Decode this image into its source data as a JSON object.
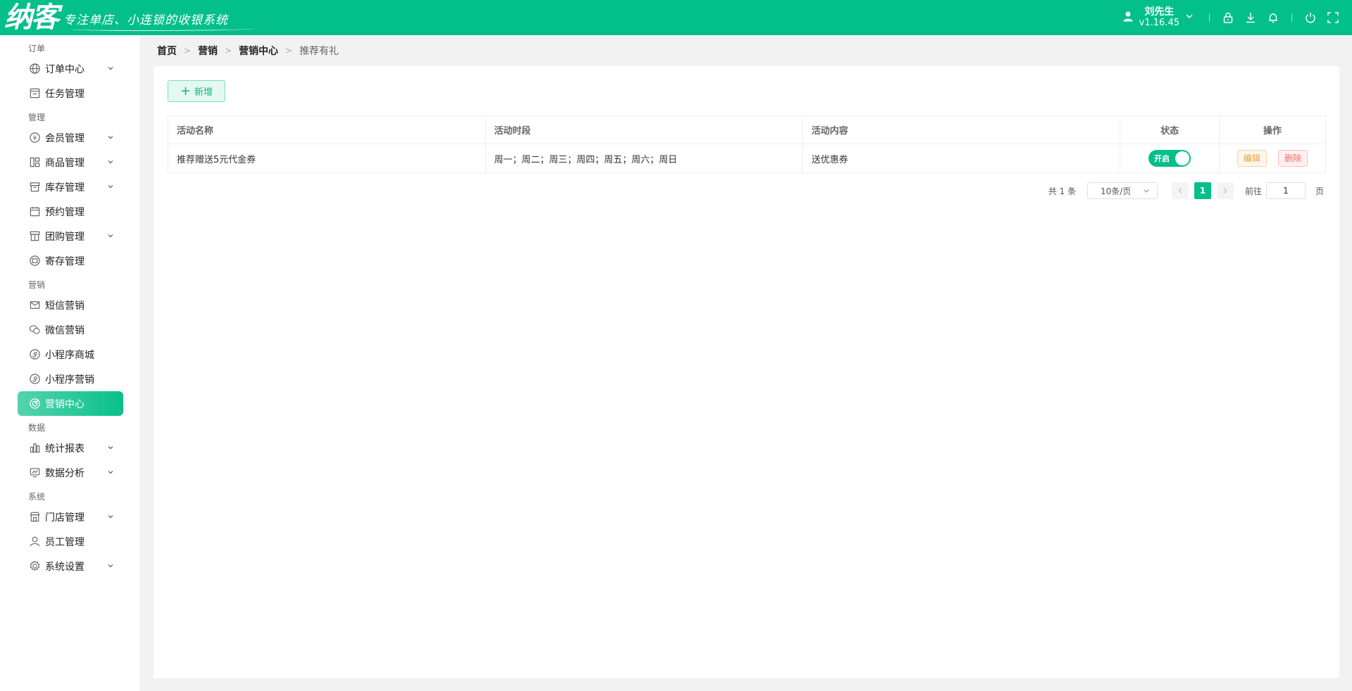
{
  "header": {
    "logo": "纳客",
    "slogan": "专注单店、小连锁的收银系统",
    "user_name": "刘先生",
    "version": "v1.16.45",
    "icons": [
      "user-icon",
      "chevron-down-icon",
      "lock-icon",
      "download-icon",
      "bell-icon",
      "power-icon",
      "fullscreen-icon"
    ]
  },
  "sidebar": {
    "groups": [
      {
        "label": "订单",
        "items": [
          {
            "label": "订单中心",
            "icon": "globe-icon",
            "chevron": true
          },
          {
            "label": "任务管理",
            "icon": "task-icon",
            "chevron": false
          }
        ]
      },
      {
        "label": "管理",
        "items": [
          {
            "label": "会员管理",
            "icon": "member-icon",
            "chevron": true
          },
          {
            "label": "商品管理",
            "icon": "goods-icon",
            "chevron": true
          },
          {
            "label": "库存管理",
            "icon": "inventory-icon",
            "chevron": true
          },
          {
            "label": "预约管理",
            "icon": "calendar-icon",
            "chevron": false
          },
          {
            "label": "团购管理",
            "icon": "groupbuy-icon",
            "chevron": true
          },
          {
            "label": "寄存管理",
            "icon": "storage-icon",
            "chevron": false
          }
        ]
      },
      {
        "label": "营销",
        "items": [
          {
            "label": "短信营销",
            "icon": "sms-icon",
            "chevron": false
          },
          {
            "label": "微信营销",
            "icon": "wechat-icon",
            "chevron": false
          },
          {
            "label": "小程序商城",
            "icon": "miniprogram-icon",
            "chevron": false
          },
          {
            "label": "小程序营销",
            "icon": "miniprogram-icon",
            "chevron": false
          },
          {
            "label": "营销中心",
            "icon": "target-icon",
            "chevron": false,
            "active": true
          }
        ]
      },
      {
        "label": "数据",
        "items": [
          {
            "label": "统计报表",
            "icon": "bar-chart-icon",
            "chevron": true
          },
          {
            "label": "数据分析",
            "icon": "analytics-icon",
            "chevron": true
          }
        ]
      },
      {
        "label": "系统",
        "items": [
          {
            "label": "门店管理",
            "icon": "store-icon",
            "chevron": true
          },
          {
            "label": "员工管理",
            "icon": "staff-icon",
            "chevron": false
          },
          {
            "label": "系统设置",
            "icon": "settings-icon",
            "chevron": true
          }
        ]
      }
    ]
  },
  "breadcrumb": [
    "首页",
    "营销",
    "营销中心",
    "推荐有礼"
  ],
  "toolbar": {
    "add_label": "新增"
  },
  "table": {
    "columns": [
      "活动名称",
      "活动时段",
      "活动内容",
      "状态",
      "操作"
    ],
    "rows": [
      {
        "name": "推荐赠送5元代金券",
        "period": "周一；周二；周三；周四；周五；周六；周日",
        "content": "送优惠券",
        "status": "开启",
        "edit": "编辑",
        "delete": "删除"
      }
    ]
  },
  "pagination": {
    "total": "共 1 条",
    "page_size": "10条/页",
    "current_page": "1",
    "goto_label": "前往",
    "goto_value": "1",
    "goto_unit": "页"
  },
  "colors": {
    "brand": "#03bf8a",
    "edit": "#e6a23c",
    "delete": "#f56c6c"
  }
}
